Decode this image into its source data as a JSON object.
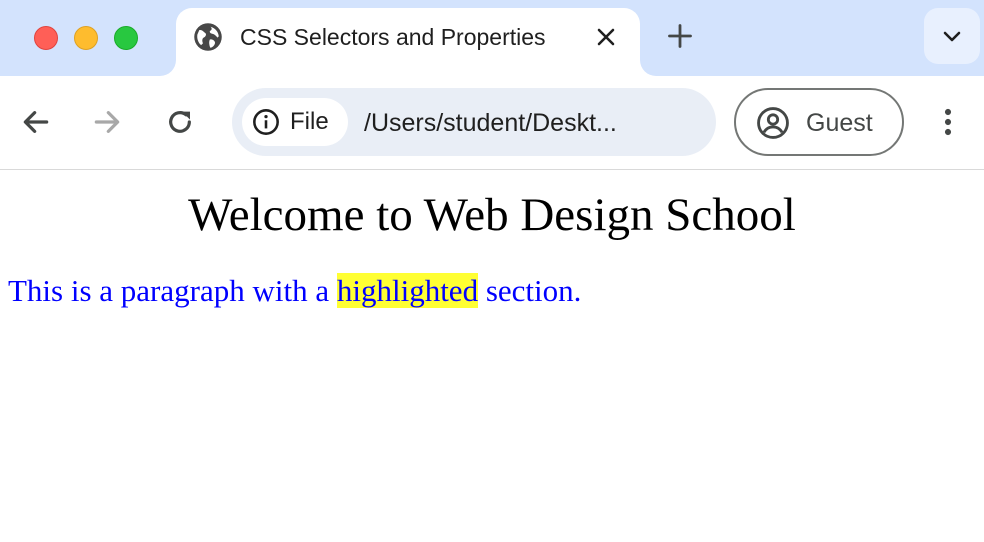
{
  "browser": {
    "tab": {
      "title": "CSS Selectors and Properties",
      "favicon": "globe-icon",
      "close_icon": "close-icon"
    },
    "new_tab_icon": "plus-icon",
    "tab_search_icon": "chevron-down-icon",
    "toolbar": {
      "back_icon": "arrow-left-icon",
      "forward_icon": "arrow-right-icon",
      "reload_icon": "reload-icon",
      "site_info": {
        "icon": "info-icon",
        "label": "File"
      },
      "address": "/Users/student/Deskt...",
      "profile": {
        "icon": "account-circle-icon",
        "label": "Guest"
      },
      "menu_icon": "more-vertical-icon"
    }
  },
  "page": {
    "heading": "Welcome to Web Design School",
    "paragraph": {
      "before": "This is a paragraph with a ",
      "highlighted": "highlighted",
      "after": " section."
    }
  },
  "colors": {
    "tabstrip_bg": "#d3e3fd",
    "omnibox_bg": "#e9eef6",
    "paragraph_text": "#0000ff",
    "highlight_bg": "#ffff33"
  }
}
